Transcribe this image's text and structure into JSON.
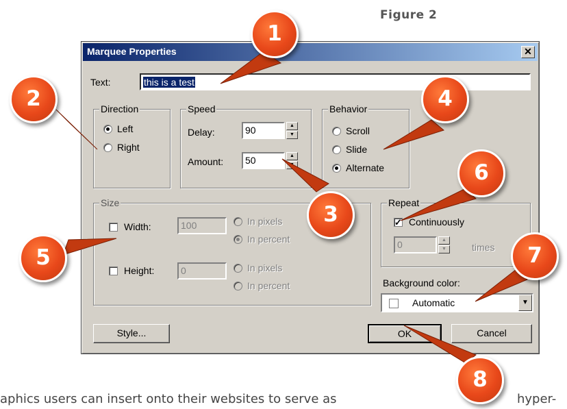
{
  "figure_label": "Figure 2",
  "bottom_text_left": "aphics users can insert onto their websites to serve as",
  "bottom_text_right": "hyper-",
  "dialog": {
    "title": "Marquee Properties",
    "close_glyph": "✕",
    "text_label": "Text:",
    "text_value": "this is a test",
    "direction": {
      "title": "Direction",
      "options": [
        "Left",
        "Right"
      ],
      "selected": "Left"
    },
    "speed": {
      "title": "Speed",
      "delay_label": "Delay:",
      "delay_value": "90",
      "amount_label": "Amount:",
      "amount_value": "50"
    },
    "behavior": {
      "title": "Behavior",
      "options": [
        "Scroll",
        "Slide",
        "Alternate"
      ],
      "selected": "Alternate"
    },
    "size": {
      "title": "Size",
      "width_label": "Width:",
      "width_value": "100",
      "width_checked": false,
      "height_label": "Height:",
      "height_value": "0",
      "height_checked": false,
      "unit_options": [
        "In pixels",
        "In percent"
      ],
      "width_unit_selected": "In percent"
    },
    "repeat": {
      "title": "Repeat",
      "continuously_label": "Continuously",
      "continuously_checked": true,
      "count_value": "0",
      "times_label": "times"
    },
    "background": {
      "label": "Background color:",
      "value": "Automatic"
    },
    "buttons": {
      "style": "Style...",
      "ok": "OK",
      "cancel": "Cancel"
    }
  },
  "callouts": [
    "1",
    "2",
    "3",
    "4",
    "5",
    "6",
    "7",
    "8"
  ],
  "colors": {
    "callout_fill": "#e8481a",
    "titlebar_start": "#0a246a",
    "titlebar_end": "#a6caf0",
    "dialog_face": "#d4d0c8"
  }
}
